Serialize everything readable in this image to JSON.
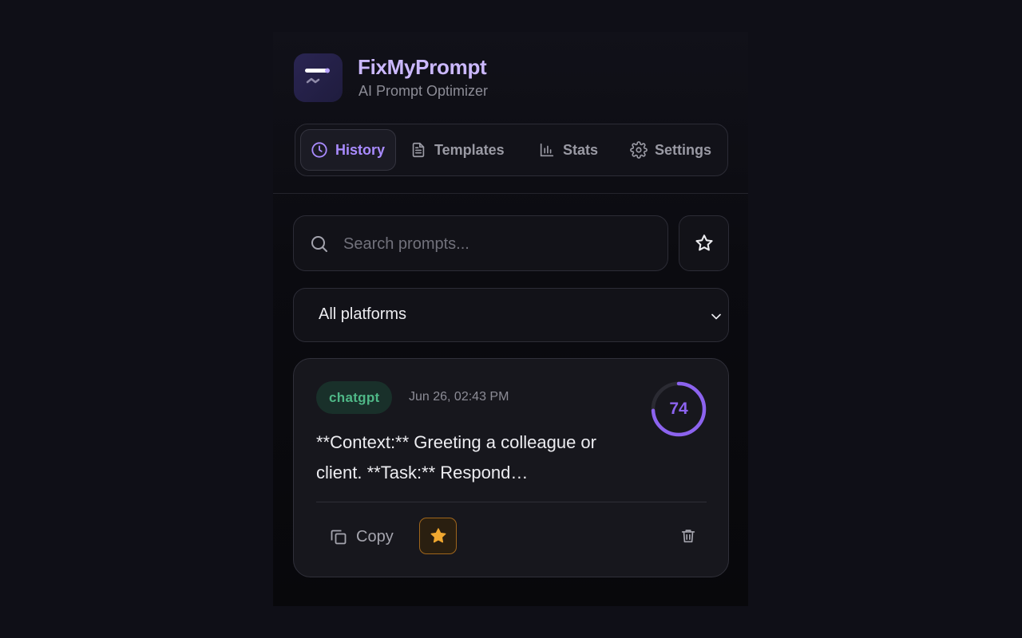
{
  "app": {
    "name": "FixMyPrompt",
    "subtitle": "AI Prompt Optimizer",
    "logo_icon": "logo-lines-icon"
  },
  "tabs": [
    {
      "label": "History",
      "icon": "clock-icon",
      "active": true
    },
    {
      "label": "Templates",
      "icon": "document-icon",
      "active": false
    },
    {
      "label": "Stats",
      "icon": "bar-chart-icon",
      "active": false
    },
    {
      "label": "Settings",
      "icon": "gear-icon",
      "active": false
    }
  ],
  "search": {
    "placeholder": "Search prompts...",
    "value": "",
    "icon": "search-icon"
  },
  "favorites_filter": {
    "icon": "star-outline-icon"
  },
  "platform_select": {
    "value": "All platforms",
    "icon": "chevron-down-icon"
  },
  "history": [
    {
      "platform": "chatgpt",
      "date": "Jun 26, 02:43 PM",
      "score": 74,
      "score_fraction": 0.74,
      "text": "**Context:** Greeting a colleague or client. **Task:** Respond…",
      "copy_label": "Copy",
      "favorited": true,
      "copy_icon": "copy-icon",
      "favorite_icon": "star-filled-icon",
      "delete_icon": "trash-icon"
    }
  ],
  "colors": {
    "accent": "#a98bff",
    "brand_title": "#cbb8ff",
    "score_ring": "#8c63ef",
    "platform_badge": "#4fb887",
    "favorite": "#f0a830",
    "background": "#0f0f17"
  }
}
